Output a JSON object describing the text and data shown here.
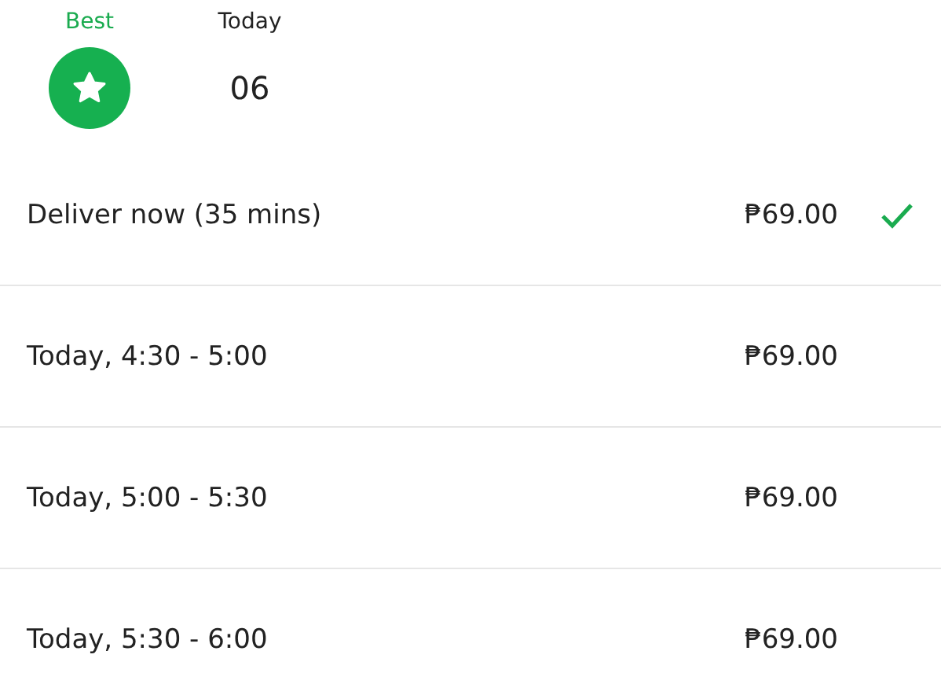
{
  "day_tabs": [
    {
      "kind": "best",
      "label": "Best",
      "selected": true
    },
    {
      "kind": "date",
      "label": "Today",
      "date": "06",
      "selected": false
    }
  ],
  "slots": [
    {
      "label": "Deliver now (35 mins)",
      "price": "₱69.00",
      "selected": true
    },
    {
      "label": "Today, 4:30 - 5:00",
      "price": "₱69.00",
      "selected": false
    },
    {
      "label": "Today, 5:00 - 5:30",
      "price": "₱69.00",
      "selected": false
    },
    {
      "label": "Today, 5:30 - 6:00",
      "price": "₱69.00",
      "selected": false
    }
  ]
}
